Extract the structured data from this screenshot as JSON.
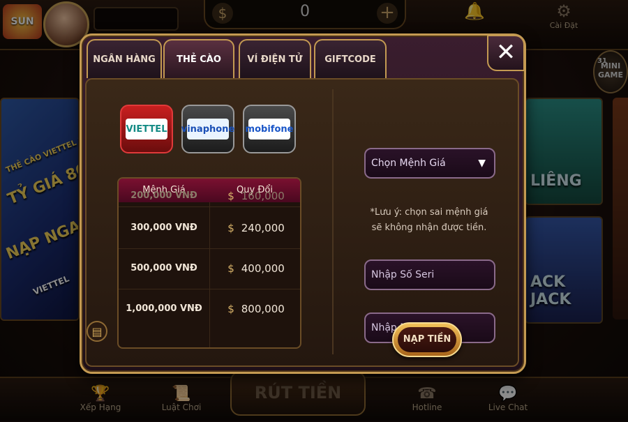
{
  "lobby": {
    "logo_text": "SUN",
    "balance": "0",
    "dollar_icon": "$",
    "plus_icon": "+",
    "settings_label": "Cài Đặt",
    "minigame_badge": "31",
    "minigame_label": "MINI GAME",
    "left_banner_lines": [
      "THẺ CÀO VIETTEL NẠP",
      "TỶ GIÁ 80",
      "NẠP NGA",
      "VIETTEL"
    ],
    "tile_lieng": "LIÊNG",
    "tile_blackjack": "ACK JACK",
    "bottom": {
      "rank": "Xếp Hạng",
      "rules": "Luật Chơi",
      "center": "RÚT TIỀN",
      "hotline": "Hotline",
      "livechat": "Live Chat"
    }
  },
  "dialog": {
    "tabs": [
      "NGÂN HÀNG",
      "THẺ CÀO",
      "VÍ ĐIỆN TỬ",
      "GIFTCODE"
    ],
    "active_tab": 1,
    "close_icon": "✕",
    "carriers": [
      "VIETTEL",
      "vinaphone",
      "mobifone"
    ],
    "selected_carrier": 0,
    "table": {
      "headers": [
        "Mệnh Giá",
        "Quy Đổi"
      ],
      "currency_icon": "$",
      "rows": [
        {
          "card": "200,000 VNĐ",
          "receive": "160,000"
        },
        {
          "card": "300,000 VNĐ",
          "receive": "240,000"
        },
        {
          "card": "500,000 VNĐ",
          "receive": "400,000"
        },
        {
          "card": "1,000,000 VNĐ",
          "receive": "800,000"
        }
      ]
    },
    "select_denomination": "Chọn Mệnh Giá",
    "note_line1": "*Lưu ý: chọn sai mệnh giá",
    "note_line2": "sẽ không nhận được tiền.",
    "serial_placeholder": "Nhập Số Seri",
    "code_placeholder": "Nhập Mã Thẻ",
    "submit_label": "NẠP TIỀN"
  }
}
